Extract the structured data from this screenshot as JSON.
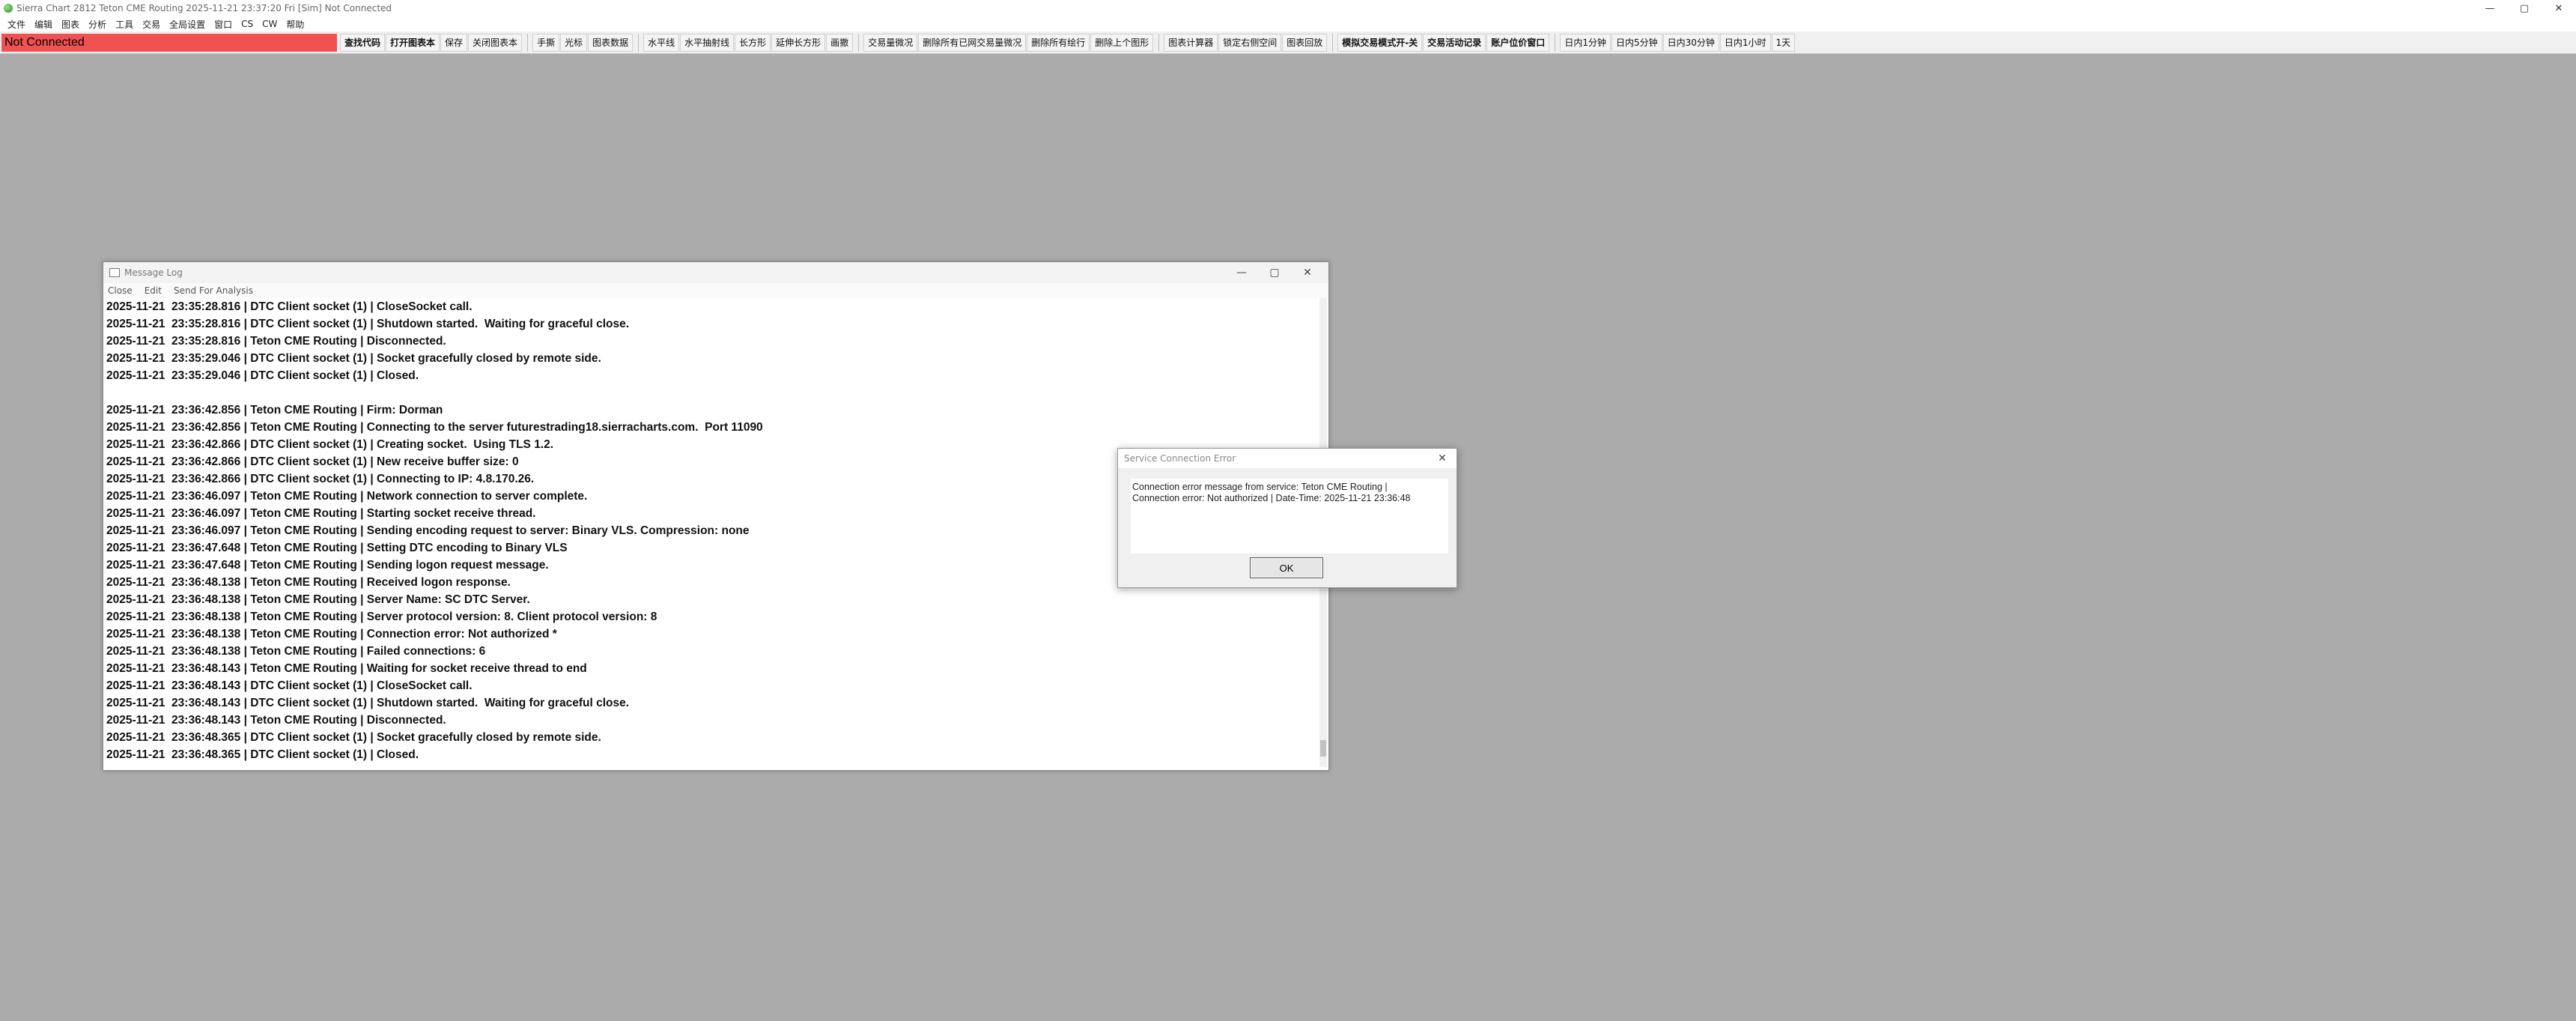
{
  "titlebar": {
    "title": "Sierra Chart 2812 Teton CME Routing 2025-11-21  23:37:20 Fri [Sim] Not Connected",
    "minimize": "—",
    "maximize": "▢",
    "close": "✕"
  },
  "menubar": {
    "items": [
      "文件",
      "编辑",
      "图表",
      "分析",
      "工具",
      "交易",
      "全局设置",
      "窗口",
      "CS",
      "CW",
      "帮助"
    ]
  },
  "toolbar": {
    "status_text": "Not Connected",
    "status_color": "#f05252",
    "group1": [
      "查找代码",
      "打开图表本",
      "保存",
      "关闭图表本"
    ],
    "group2": [
      "手撕",
      "光标",
      "图表数据"
    ],
    "group3": [
      "水平线",
      "水平抽射线",
      "长方形",
      "延伸长方形",
      "画撤"
    ],
    "group4": [
      "交易量微况",
      "删除所有已网交易量微况",
      "删除所有绘行",
      "删除上个图形"
    ],
    "group5": [
      "图表计算器",
      "锁定右侧空间",
      "图表回放"
    ],
    "group6": [
      "模拟交易模式开-关",
      "交易活动记录",
      "账户位价窗口"
    ],
    "group7": [
      "日内1分钟",
      "日内5分钟",
      "日内30分钟",
      "日内1小时",
      "1天"
    ]
  },
  "message_log": {
    "title": "Message Log",
    "menu": [
      "Close",
      "Edit",
      "Send For Analysis"
    ],
    "lines": [
      "2025-11-21  23:35:28.816 | DTC Client socket (1) | CloseSocket call.",
      "2025-11-21  23:35:28.816 | DTC Client socket (1) | Shutdown started.  Waiting for graceful close.",
      "2025-11-21  23:35:28.816 | Teton CME Routing | Disconnected.",
      "2025-11-21  23:35:29.046 | DTC Client socket (1) | Socket gracefully closed by remote side.",
      "2025-11-21  23:35:29.046 | DTC Client socket (1) | Closed.",
      "",
      "2025-11-21  23:36:42.856 | Teton CME Routing | Firm: Dorman",
      "2025-11-21  23:36:42.856 | Teton CME Routing | Connecting to the server futurestrading18.sierracharts.com.  Port 11090",
      "2025-11-21  23:36:42.866 | DTC Client socket (1) | Creating socket.  Using TLS 1.2.",
      "2025-11-21  23:36:42.866 | DTC Client socket (1) | New receive buffer size: 0",
      "2025-11-21  23:36:42.866 | DTC Client socket (1) | Connecting to IP: 4.8.170.26.",
      "2025-11-21  23:36:46.097 | Teton CME Routing | Network connection to server complete.",
      "2025-11-21  23:36:46.097 | Teton CME Routing | Starting socket receive thread.",
      "2025-11-21  23:36:46.097 | Teton CME Routing | Sending encoding request to server: Binary VLS. Compression: none",
      "2025-11-21  23:36:47.648 | Teton CME Routing | Setting DTC encoding to Binary VLS",
      "2025-11-21  23:36:47.648 | Teton CME Routing | Sending logon request message.",
      "2025-11-21  23:36:48.138 | Teton CME Routing | Received logon response.",
      "2025-11-21  23:36:48.138 | Teton CME Routing | Server Name: SC DTC Server.",
      "2025-11-21  23:36:48.138 | Teton CME Routing | Server protocol version: 8. Client protocol version: 8",
      "2025-11-21  23:36:48.138 | Teton CME Routing | Connection error: Not authorized *",
      "2025-11-21  23:36:48.138 | Teton CME Routing | Failed connections: 6",
      "2025-11-21  23:36:48.143 | Teton CME Routing | Waiting for socket receive thread to end",
      "2025-11-21  23:36:48.143 | DTC Client socket (1) | CloseSocket call.",
      "2025-11-21  23:36:48.143 | DTC Client socket (1) | Shutdown started.  Waiting for graceful close.",
      "2025-11-21  23:36:48.143 | Teton CME Routing | Disconnected.",
      "2025-11-21  23:36:48.365 | DTC Client socket (1) | Socket gracefully closed by remote side.",
      "2025-11-21  23:36:48.365 | DTC Client socket (1) | Closed."
    ]
  },
  "error_dialog": {
    "title": "Service Connection Error",
    "message_line1": "Connection error message from service: Teton CME Routing |",
    "message_line2": "Connection error: Not authorized | Date-Time: 2025-11-21  23:36:48",
    "ok_label": "OK"
  }
}
